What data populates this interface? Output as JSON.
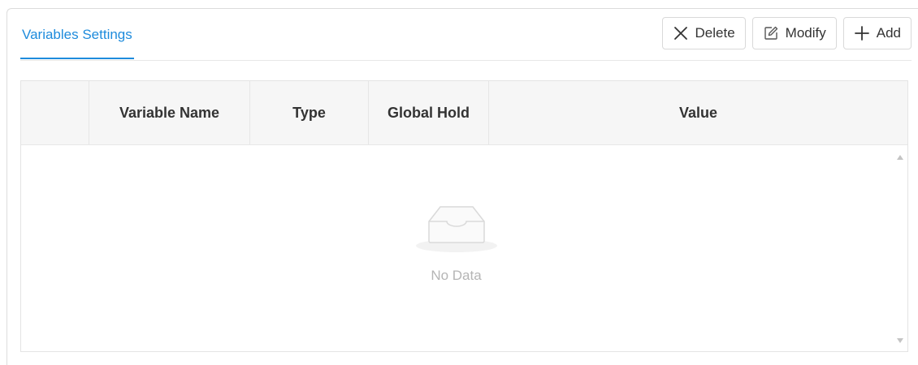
{
  "panel": {
    "tab_label": "Variables Settings"
  },
  "toolbar": {
    "delete_label": "Delete",
    "modify_label": "Modify",
    "add_label": "Add"
  },
  "table": {
    "columns": [
      "",
      "Variable Name",
      "Type",
      "Global Hold",
      "Value"
    ],
    "rows": [],
    "empty_text": "No Data"
  },
  "icons": {
    "delete": "close-icon",
    "modify": "edit-icon",
    "add": "plus-icon",
    "empty": "empty-inbox-icon"
  },
  "colors": {
    "accent": "#1e8bdc",
    "header_bg": "#f6f6f6",
    "border": "#e4e4e4",
    "muted_text": "#b5b5b5"
  }
}
